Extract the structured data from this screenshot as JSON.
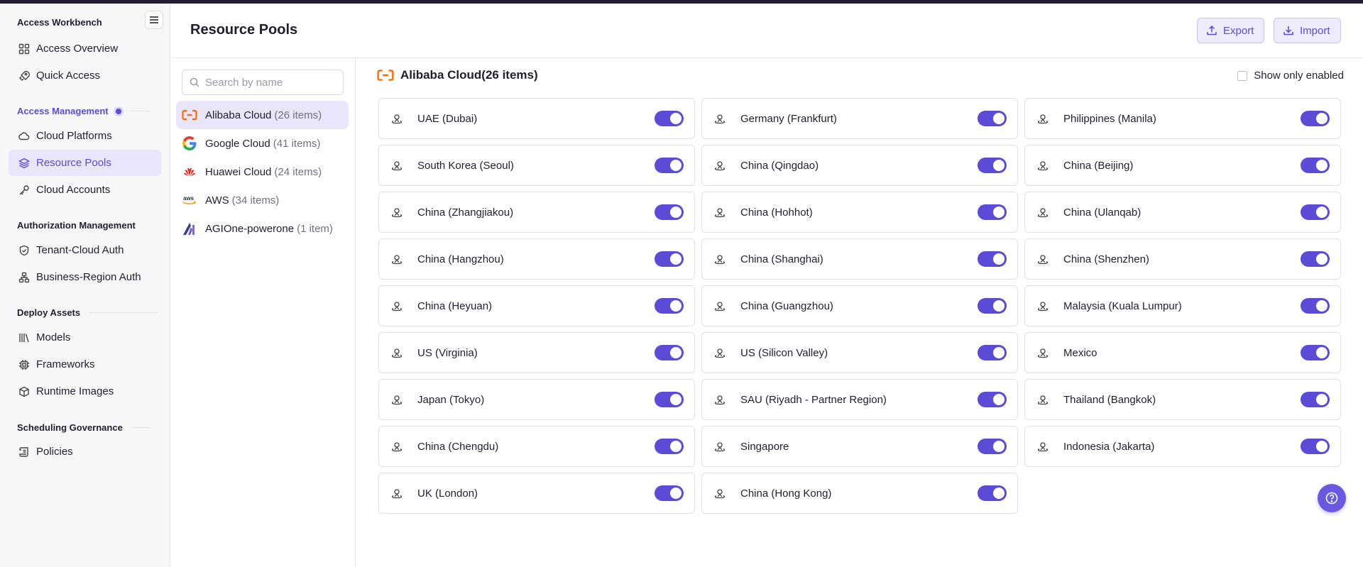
{
  "sidebar": {
    "title": "Access Workbench",
    "items_top": [
      {
        "label": "Access Overview",
        "icon": "grid-icon"
      },
      {
        "label": "Quick Access",
        "icon": "rocket-icon"
      }
    ],
    "groups": [
      {
        "label": "Access Management",
        "items": [
          {
            "label": "Cloud Platforms",
            "icon": "cloud-icon"
          },
          {
            "label": "Resource Pools",
            "icon": "layers-icon"
          },
          {
            "label": "Cloud Accounts",
            "icon": "key-icon"
          }
        ]
      },
      {
        "label": "Authorization Management",
        "items": [
          {
            "label": "Tenant-Cloud Auth",
            "icon": "shield-icon"
          },
          {
            "label": "Business-Region Auth",
            "icon": "hierarchy-icon"
          }
        ]
      },
      {
        "label": "Deploy Assets",
        "items": [
          {
            "label": "Models",
            "icon": "library-icon"
          },
          {
            "label": "Frameworks",
            "icon": "chip-icon"
          },
          {
            "label": "Runtime Images",
            "icon": "box-icon"
          }
        ]
      },
      {
        "label": "Scheduling Governance",
        "items": [
          {
            "label": "Policies",
            "icon": "scroll-icon"
          }
        ]
      }
    ],
    "active_item": "Resource Pools"
  },
  "header": {
    "title": "Resource Pools",
    "export_label": "Export",
    "import_label": "Import"
  },
  "providers": {
    "search_placeholder": "Search by name",
    "items": [
      {
        "name": "Alibaba Cloud",
        "count": "(26 items)",
        "logo": "alibaba-cloud-logo"
      },
      {
        "name": "Google Cloud",
        "count": "(41 items)",
        "logo": "google-cloud-logo"
      },
      {
        "name": "Huawei Cloud",
        "count": "(24 items)",
        "logo": "huawei-cloud-logo"
      },
      {
        "name": "AWS",
        "count": "(34 items)",
        "logo": "aws-logo"
      },
      {
        "name": "AGIOne-powerone",
        "count": "(1 item)",
        "logo": "agione-logo"
      }
    ],
    "selected": "Alibaba Cloud"
  },
  "content": {
    "title": "Alibaba Cloud(26 items)",
    "show_only_enabled_label": "Show only enabled",
    "show_only_enabled": false,
    "regions": [
      {
        "name": "UAE (Dubai)",
        "enabled": true
      },
      {
        "name": "Germany (Frankfurt)",
        "enabled": true
      },
      {
        "name": "Philippines (Manila)",
        "enabled": true
      },
      {
        "name": "South Korea (Seoul)",
        "enabled": true
      },
      {
        "name": "China (Qingdao)",
        "enabled": true
      },
      {
        "name": "China (Beijing)",
        "enabled": true
      },
      {
        "name": "China (Zhangjiakou)",
        "enabled": true
      },
      {
        "name": "China (Hohhot)",
        "enabled": true
      },
      {
        "name": "China (Ulanqab)",
        "enabled": true
      },
      {
        "name": "China (Hangzhou)",
        "enabled": true
      },
      {
        "name": "China (Shanghai)",
        "enabled": true
      },
      {
        "name": "China (Shenzhen)",
        "enabled": true
      },
      {
        "name": "China (Heyuan)",
        "enabled": true
      },
      {
        "name": "China (Guangzhou)",
        "enabled": true
      },
      {
        "name": "Malaysia (Kuala Lumpur)",
        "enabled": true
      },
      {
        "name": "US (Virginia)",
        "enabled": true
      },
      {
        "name": "US (Silicon Valley)",
        "enabled": true
      },
      {
        "name": "Mexico",
        "enabled": true
      },
      {
        "name": "Japan (Tokyo)",
        "enabled": true
      },
      {
        "name": "SAU (Riyadh - Partner Region)",
        "enabled": true
      },
      {
        "name": "Thailand (Bangkok)",
        "enabled": true
      },
      {
        "name": "China (Chengdu)",
        "enabled": true
      },
      {
        "name": "Singapore",
        "enabled": true
      },
      {
        "name": "Indonesia (Jakarta)",
        "enabled": true
      },
      {
        "name": "UK (London)",
        "enabled": true
      },
      {
        "name": "China (Hong Kong)",
        "enabled": true
      }
    ]
  },
  "colors": {
    "accent": "#5b4bd6",
    "active_bg": "#e9e6fb",
    "alibaba_orange": "#ff6a00"
  }
}
